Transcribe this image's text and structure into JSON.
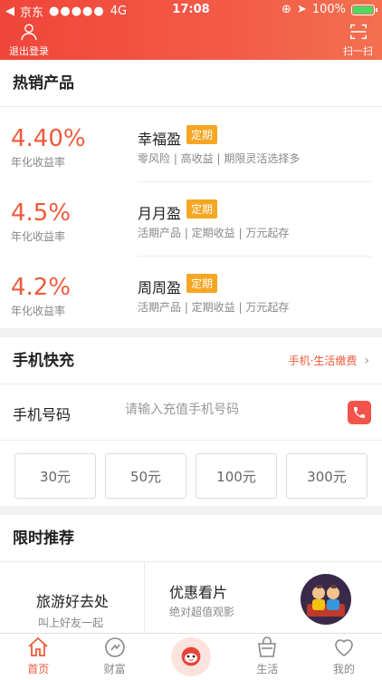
{
  "status_bar": {
    "carrier": "京东",
    "network": "4G",
    "time": "17:08",
    "battery": "100%",
    "battery_level": 1.0
  },
  "header": {
    "logout_label": "退出登录",
    "scan_label": "扫一扫"
  },
  "hot_products": {
    "title": "热销产品",
    "items": [
      {
        "rate": "4.40%",
        "rate_label": "年化收益率",
        "name": "幸福盈",
        "tag": "定期",
        "desc": "零风险 | 高收益 | 期限灵活选择多"
      },
      {
        "rate": "4.5%",
        "rate_label": "年化收益率",
        "name": "月月盈",
        "tag": "定期",
        "desc": "活期产品 | 定期收益 | 万元起存"
      },
      {
        "rate": "4.2%",
        "rate_label": "年化收益率",
        "name": "周周盈",
        "tag": "定期",
        "desc": "活期产品 | 定期收益 | 万元起存"
      }
    ]
  },
  "recharge": {
    "title": "手机快充",
    "link": "手机·生活缴费",
    "phone_label": "手机号码",
    "phone_placeholder": "请输入充值手机号码",
    "phone_value": "",
    "amounts": [
      "30元",
      "50元",
      "100元",
      "300元"
    ]
  },
  "recommend": {
    "title": "限时推荐",
    "cards": [
      {
        "title": "旅游好去处",
        "sub": "叫上好友一起"
      },
      {
        "title": "优惠看片",
        "sub": "绝对超值观影"
      }
    ]
  },
  "tabbar": {
    "items": [
      {
        "label": "首页",
        "icon": "home-icon"
      },
      {
        "label": "财富",
        "icon": "wealth-icon"
      },
      {
        "label": "",
        "icon": "mascot-icon"
      },
      {
        "label": "生活",
        "icon": "bag-icon"
      },
      {
        "label": "我的",
        "icon": "heart-icon"
      }
    ]
  },
  "colors": {
    "brand": "#f0453a",
    "accent": "#f05a3c",
    "tag": "#f5a623"
  }
}
